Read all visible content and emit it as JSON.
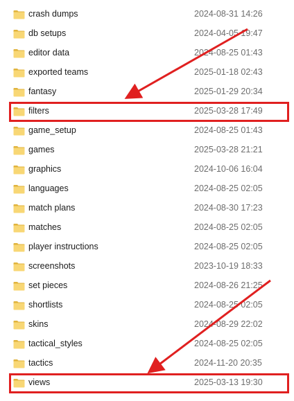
{
  "folders": [
    {
      "name": "crash dumps",
      "modified": "2024-08-31 14:26"
    },
    {
      "name": "db setups",
      "modified": "2024-04-05 19:47"
    },
    {
      "name": "editor data",
      "modified": "2024-08-25 01:43"
    },
    {
      "name": "exported teams",
      "modified": "2025-01-18 02:43"
    },
    {
      "name": "fantasy",
      "modified": "2025-01-29 20:34"
    },
    {
      "name": "filters",
      "modified": "2025-03-28 17:49"
    },
    {
      "name": "game_setup",
      "modified": "2024-08-25 01:43"
    },
    {
      "name": "games",
      "modified": "2025-03-28 21:21"
    },
    {
      "name": "graphics",
      "modified": "2024-10-06 16:04"
    },
    {
      "name": "languages",
      "modified": "2024-08-25 02:05"
    },
    {
      "name": "match plans",
      "modified": "2024-08-30 17:23"
    },
    {
      "name": "matches",
      "modified": "2024-08-25 02:05"
    },
    {
      "name": "player instructions",
      "modified": "2024-08-25 02:05"
    },
    {
      "name": "screenshots",
      "modified": "2023-10-19 18:33"
    },
    {
      "name": "set pieces",
      "modified": "2024-08-26 21:25"
    },
    {
      "name": "shortlists",
      "modified": "2024-08-25 02:05"
    },
    {
      "name": "skins",
      "modified": "2024-08-29 22:02"
    },
    {
      "name": "tactical_styles",
      "modified": "2024-08-25 02:05"
    },
    {
      "name": "tactics",
      "modified": "2024-11-20 20:35"
    },
    {
      "name": "views",
      "modified": "2025-03-13 19:30"
    }
  ],
  "highlighted_folders": [
    "filters",
    "views"
  ],
  "icon": "folder-icon",
  "colors": {
    "folder": "#f8d775",
    "folder_dark": "#e0b33d",
    "annotation": "#e02020",
    "name_text": "#1a1a1a",
    "date_text": "#6d6d6d"
  }
}
